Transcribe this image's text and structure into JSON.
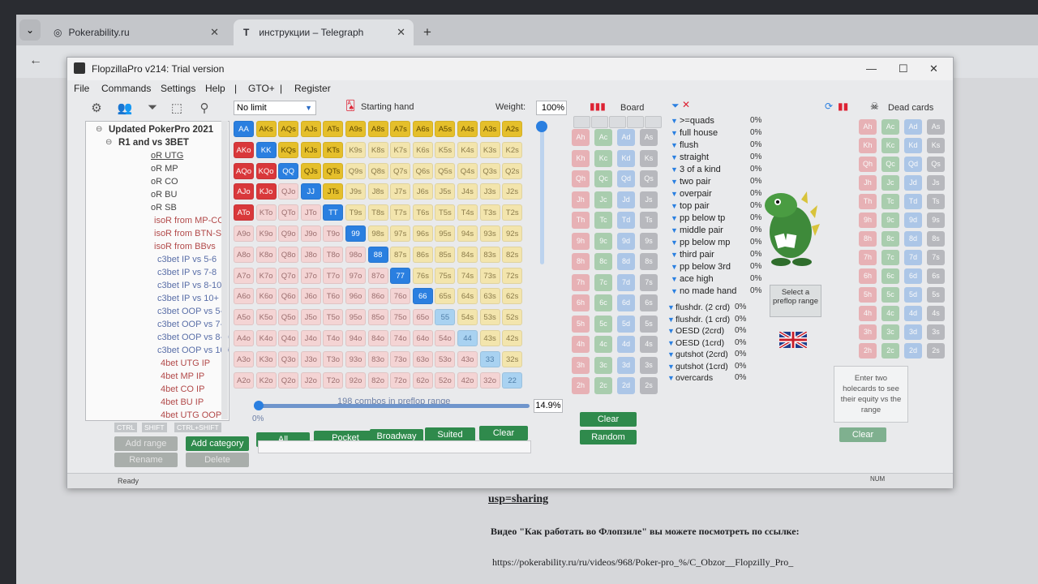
{
  "browser": {
    "tabs": [
      {
        "label": "Pokerability.ru"
      },
      {
        "label": "инструкции – Telegraph"
      }
    ],
    "new_tab": "+",
    "page_text": {
      "line1": "usp=sharing",
      "line2": "Видео \"Как работать во Флопзиле\" вы можете посмотреть по ссылке:",
      "line3": "https://pokerability.ru/ru/videos/968/Poker-pro_%/C_Obzor__Flopzilly_Pro_"
    }
  },
  "app": {
    "title": "FlopzillaPro v214: Trial version",
    "menu": [
      "File",
      "Commands",
      "Settings",
      "Help",
      "|",
      "GTO+",
      "|",
      "Register"
    ],
    "game_type": "No limit",
    "starting_hand_label": "Starting hand",
    "weight_label": "Weight:",
    "weight_value": "100%",
    "board_label": "Board",
    "dead_cards_label": "Dead cards",
    "combos_text": "198 combos in preflop range",
    "range_percent": "14.9%",
    "slider_min": "0%",
    "status": "Ready",
    "num": "NUM",
    "select_preflop": "Select a preflop range",
    "enter_holecards": "Enter two holecards to see their equity vs the range",
    "tree": [
      {
        "text": "Updated PokerPro 2021",
        "bold": true,
        "color": "#333"
      },
      {
        "text": "R1 and vs 3BET",
        "bold": true,
        "color": "#333"
      },
      {
        "text": "oR UTG",
        "color": "#444"
      },
      {
        "text": "oR MP",
        "color": "#444"
      },
      {
        "text": "oR CO",
        "color": "#444"
      },
      {
        "text": "oR BU",
        "color": "#444"
      },
      {
        "text": "oR SB",
        "color": "#444"
      },
      {
        "text": "isoR from MP-CO",
        "color": "#b24a4a"
      },
      {
        "text": "isoR from BTN-SB",
        "color": "#b24a4a"
      },
      {
        "text": "isoR from BBvs",
        "color": "#b24a4a"
      },
      {
        "text": "c3bet IP vs 5-6",
        "color": "#5a6fa8"
      },
      {
        "text": "c3bet IP vs 7-8",
        "color": "#5a6fa8"
      },
      {
        "text": "c3bet IP vs 8-10",
        "color": "#5a6fa8"
      },
      {
        "text": "c3bet IP vs 10+",
        "color": "#5a6fa8"
      },
      {
        "text": "c3bet OOP vs 5-6",
        "color": "#5a6fa8"
      },
      {
        "text": "c3bet OOP vs 7-8",
        "color": "#5a6fa8"
      },
      {
        "text": "c3bet OOP vs 8-10",
        "color": "#5a6fa8"
      },
      {
        "text": "c3bet OOP vs 10+",
        "color": "#5a6fa8"
      },
      {
        "text": "4bet UTG IP",
        "color": "#b24a4a"
      },
      {
        "text": "4bet MP IP",
        "color": "#b24a4a"
      },
      {
        "text": "4bet CO IP",
        "color": "#b24a4a"
      },
      {
        "text": "4bet BU IP",
        "color": "#b24a4a"
      },
      {
        "text": "4bet UTG OOP",
        "color": "#b24a4a"
      }
    ],
    "tree_buttons": [
      "CTRL",
      "SHIFT",
      "CTRL+SHIFT"
    ],
    "left_buttons": [
      "Add range",
      "Add category",
      "Rename",
      "Delete"
    ],
    "range_buttons": [
      "All",
      "Pocket",
      "Broadway",
      "Suited",
      "Clear"
    ],
    "board_buttons": [
      "Clear",
      "Random"
    ],
    "dead_clear": "Clear",
    "ranks": [
      "A",
      "K",
      "Q",
      "J",
      "T",
      "9",
      "8",
      "7",
      "6",
      "5",
      "4",
      "3",
      "2"
    ],
    "selected_hands": [
      "AA",
      "AKs",
      "AQs",
      "AJs",
      "ATs",
      "A9s",
      "A8s",
      "A7s",
      "A6s",
      "A5s",
      "A4s",
      "A3s",
      "A2s",
      "AKo",
      "KK",
      "KQs",
      "KJs",
      "KTs",
      "AQo",
      "KQo",
      "QQ",
      "QJs",
      "QTs",
      "AJo",
      "KJo",
      "JJ",
      "JTs",
      "ATo",
      "TT",
      "99",
      "88",
      "77",
      "66"
    ],
    "filters_made": [
      {
        "label": ">=quads",
        "pct": "0%"
      },
      {
        "label": "full house",
        "pct": "0%"
      },
      {
        "label": "flush",
        "pct": "0%"
      },
      {
        "label": "straight",
        "pct": "0%"
      },
      {
        "label": "3 of a kind",
        "pct": "0%"
      },
      {
        "label": "two pair",
        "pct": "0%"
      },
      {
        "label": "overpair",
        "pct": "0%"
      },
      {
        "label": "top pair",
        "pct": "0%"
      },
      {
        "label": "pp below tp",
        "pct": "0%"
      },
      {
        "label": "middle pair",
        "pct": "0%"
      },
      {
        "label": "pp below mp",
        "pct": "0%"
      },
      {
        "label": "third pair",
        "pct": "0%"
      },
      {
        "label": "pp below 3rd",
        "pct": "0%"
      },
      {
        "label": "ace high",
        "pct": "0%"
      },
      {
        "label": "no made hand",
        "pct": "0%"
      }
    ],
    "filters_draws": [
      {
        "label": "flushdr. (2 crd)",
        "pct": "0%"
      },
      {
        "label": "flushdr. (1 crd)",
        "pct": "0%"
      },
      {
        "label": "OESD (2crd)",
        "pct": "0%"
      },
      {
        "label": "OESD (1crd)",
        "pct": "0%"
      },
      {
        "label": "gutshot (2crd)",
        "pct": "0%"
      },
      {
        "label": "gutshot (1crd)",
        "pct": "0%"
      },
      {
        "label": "overcards",
        "pct": "0%"
      }
    ]
  }
}
